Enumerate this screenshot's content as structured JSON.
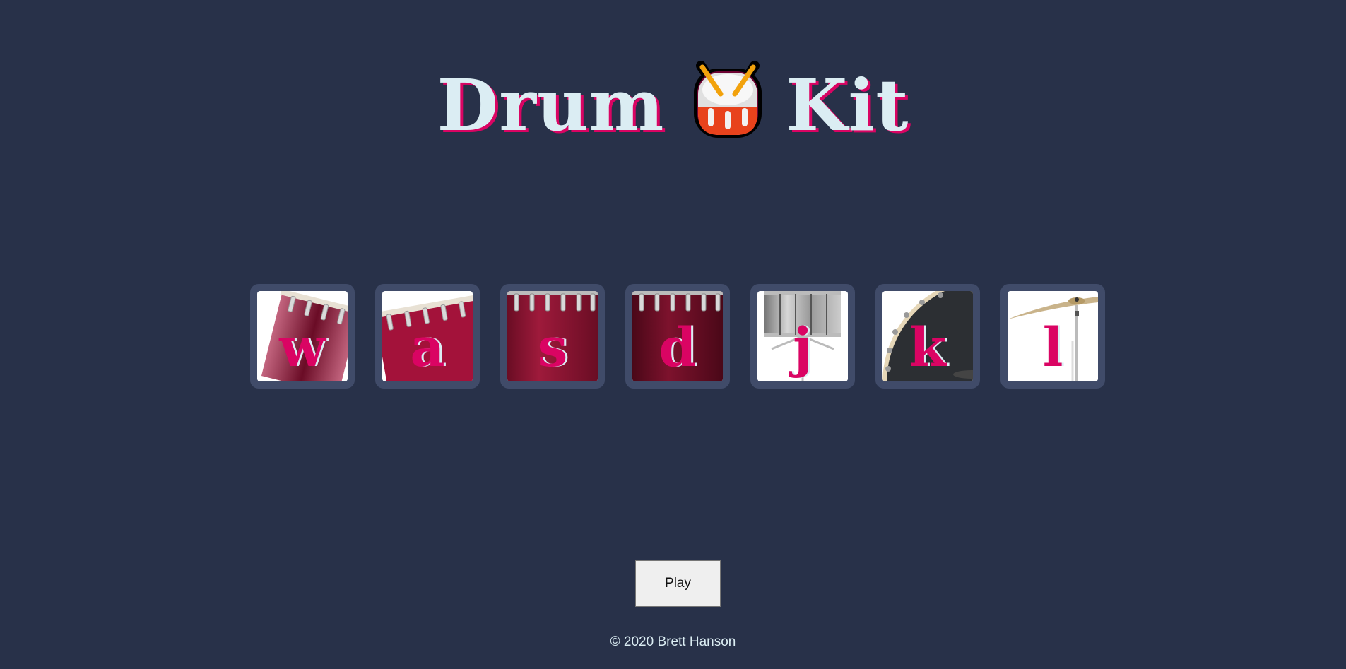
{
  "header": {
    "title_left": "Drum",
    "title_right": "Kit",
    "emoji_icon": "drum-emoji-icon"
  },
  "drums": [
    {
      "key": "w",
      "instrument": "tom1-icon",
      "color": "#a3123a"
    },
    {
      "key": "a",
      "instrument": "tom2-icon",
      "color": "#a3123a"
    },
    {
      "key": "s",
      "instrument": "tom3-icon",
      "color": "#8f1533"
    },
    {
      "key": "d",
      "instrument": "tom4-icon",
      "color": "#6e0f28"
    },
    {
      "key": "j",
      "instrument": "snare-icon",
      "color": "#9a9a9a"
    },
    {
      "key": "k",
      "instrument": "kick-bass-icon",
      "color": "#2b2e31"
    },
    {
      "key": "l",
      "instrument": "crash-cymbal-icon",
      "color": "#c9b38a"
    }
  ],
  "controls": {
    "play_label": "Play"
  },
  "footer": {
    "copyright": "© 2020 Brett Hanson"
  },
  "colors": {
    "background": "#283149",
    "tile_border": "#404b69",
    "accent": "#da0463",
    "text_light": "#dbedf3"
  }
}
